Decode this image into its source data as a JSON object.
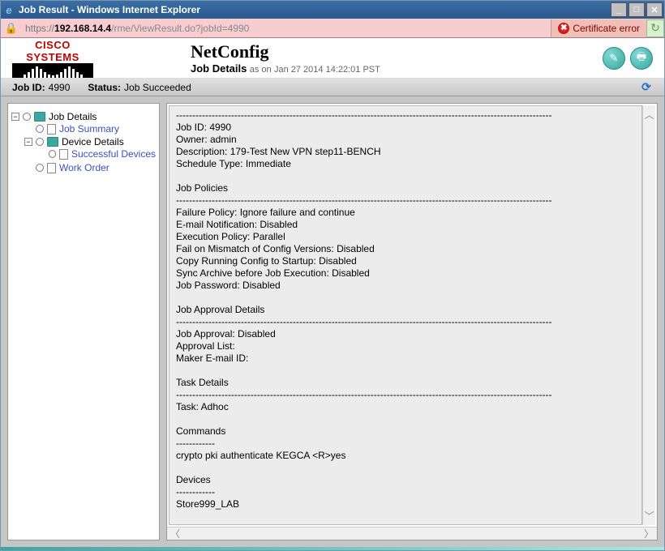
{
  "window": {
    "title": "Job Result - Windows Internet Explorer"
  },
  "address": {
    "protocol": "https://",
    "host": "192.168.14.4",
    "path": "/rme/ViewResult.do?jobId=4990"
  },
  "cert": {
    "label": "Certificate error"
  },
  "header": {
    "brand": "CISCO SYSTEMS",
    "app": "NetConfig",
    "subtitle": "Job Details",
    "timestamp_prefix": "as on",
    "timestamp": "Jan 27 2014 14:22:01 PST"
  },
  "infobar": {
    "job_id_label": "Job ID:",
    "job_id": "4990",
    "status_label": "Status:",
    "status": "Job Succeeded"
  },
  "tree": {
    "root": "Job Details",
    "summary": "Job Summary",
    "device_details": "Device Details",
    "successful": "Successful Devices",
    "work_order": "Work Order"
  },
  "details": {
    "divider": "--------------------------------------------------------------------------------------------------------------------",
    "short_dash": "------------",
    "mid_dash": "----------------------------",
    "lines_main": [
      "Job ID: 4990",
      "Owner: admin",
      "Description: 179-Test New VPN step11-BENCH",
      "Schedule Type: Immediate"
    ],
    "section_policies": "Job Policies",
    "lines_policies": [
      "Failure Policy: Ignore failure and continue",
      "E-mail Notification: Disabled",
      "Execution Policy: Parallel",
      "Fail on Mismatch of Config Versions: Disabled",
      "Copy Running Config to Startup: Disabled",
      "Sync Archive before Job Execution: Disabled",
      "Job Password: Disabled"
    ],
    "section_approval": "Job Approval Details",
    "lines_approval": [
      "Job Approval: Disabled",
      "Approval List:",
      "Maker E-mail ID:"
    ],
    "section_task": "Task Details",
    "lines_task": [
      "Task: Adhoc"
    ],
    "section_commands": "Commands",
    "lines_commands": [
      "crypto pki authenticate KEGCA <R>yes"
    ],
    "section_devices": "Devices",
    "lines_devices": [
      "Store999_LAB"
    ]
  }
}
